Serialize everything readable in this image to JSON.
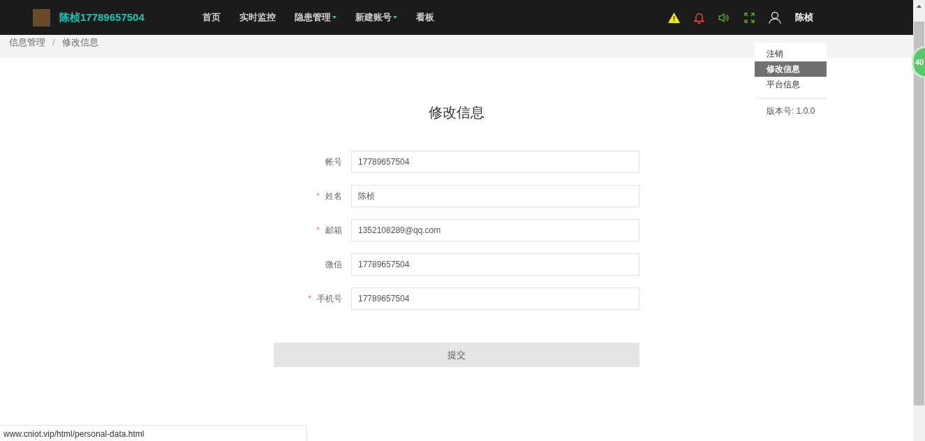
{
  "navbar": {
    "brand": "陈桢17789657504",
    "items": [
      {
        "label": "首页",
        "dropdown": false
      },
      {
        "label": "实时监控",
        "dropdown": false
      },
      {
        "label": "隐患管理",
        "dropdown": true
      },
      {
        "label": "新建账号",
        "dropdown": true
      },
      {
        "label": "看板",
        "dropdown": false
      }
    ],
    "user": "陈桢"
  },
  "breadcrumb": {
    "items": [
      "信息管理",
      "修改信息"
    ],
    "separator": "/"
  },
  "user_menu": {
    "items": [
      {
        "label": "注销",
        "selected": false
      },
      {
        "label": "修改信息",
        "selected": true
      },
      {
        "label": "平台信息",
        "selected": false
      }
    ],
    "version": "版本号: 1.0.0"
  },
  "form": {
    "title": "修改信息",
    "required_mark": "*",
    "fields": [
      {
        "label": "帐号",
        "required": false,
        "value": "17789657504"
      },
      {
        "label": "姓名",
        "required": true,
        "value": "陈桢"
      },
      {
        "label": "邮箱",
        "required": true,
        "value": "1352108289@qq.com"
      },
      {
        "label": "微信",
        "required": false,
        "value": "17789657504"
      },
      {
        "label": "手机号",
        "required": true,
        "value": "17789657504"
      }
    ],
    "submit": "提交"
  },
  "floating_badge": "40",
  "status_url": "www.cniot.vip/html/personal-data.html"
}
